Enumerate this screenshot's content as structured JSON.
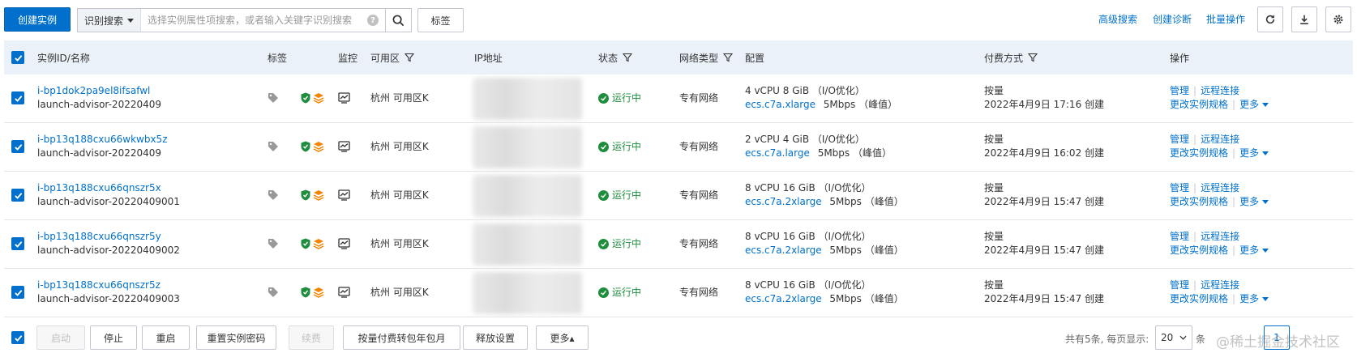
{
  "toolbar": {
    "create_label": "创建实例",
    "search_mode": "识别搜索",
    "search_placeholder": "选择实例属性项搜索，或者输入关键字识别搜索",
    "tag_label": "标签",
    "advanced_search": "高级搜索",
    "create_diagnosis": "创建诊断",
    "batch_ops": "批量操作"
  },
  "columns": {
    "instance": "实例ID/名称",
    "tags": "标签",
    "monitor": "监控",
    "zone": "可用区",
    "ip": "IP地址",
    "status": "状态",
    "network": "网络类型",
    "config": "配置",
    "billing": "付费方式",
    "actions": "操作"
  },
  "rows": [
    {
      "id": "i-bp1dok2pa9el8ifsafwl",
      "name": "launch-advisor-20220409",
      "zone": "杭州 可用区K",
      "status": "运行中",
      "network": "专有网络",
      "spec": "4 vCPU 8 GiB （I/O优化）",
      "type": "ecs.c7a.xlarge",
      "bandwidth": "5Mbps （峰值）",
      "billing": "按量",
      "created": "2022年4月9日 17:16 创建"
    },
    {
      "id": "i-bp13q188cxu66wkwbx5z",
      "name": "launch-advisor-20220409",
      "zone": "杭州 可用区K",
      "status": "运行中",
      "network": "专有网络",
      "spec": "2 vCPU 4 GiB （I/O优化）",
      "type": "ecs.c7a.large",
      "bandwidth": "5Mbps （峰值）",
      "billing": "按量",
      "created": "2022年4月9日 16:02 创建"
    },
    {
      "id": "i-bp13q188cxu66qnszr5x",
      "name": "launch-advisor-20220409001",
      "zone": "杭州 可用区K",
      "status": "运行中",
      "network": "专有网络",
      "spec": "8 vCPU 16 GiB （I/O优化）",
      "type": "ecs.c7a.2xlarge",
      "bandwidth": "5Mbps （峰值）",
      "billing": "按量",
      "created": "2022年4月9日 15:47 创建"
    },
    {
      "id": "i-bp13q188cxu66qnszr5y",
      "name": "launch-advisor-20220409002",
      "zone": "杭州 可用区K",
      "status": "运行中",
      "network": "专有网络",
      "spec": "8 vCPU 16 GiB （I/O优化）",
      "type": "ecs.c7a.2xlarge",
      "bandwidth": "5Mbps （峰值）",
      "billing": "按量",
      "created": "2022年4月9日 15:47 创建"
    },
    {
      "id": "i-bp13q188cxu66qnszr5z",
      "name": "launch-advisor-20220409003",
      "zone": "杭州 可用区K",
      "status": "运行中",
      "network": "专有网络",
      "spec": "8 vCPU 16 GiB （I/O优化）",
      "type": "ecs.c7a.2xlarge",
      "bandwidth": "5Mbps （峰值）",
      "billing": "按量",
      "created": "2022年4月9日 15:47 创建"
    }
  ],
  "row_actions": {
    "manage": "管理",
    "remote": "远程连接",
    "change_spec": "更改实例规格",
    "more": "更多"
  },
  "footer": {
    "start": "启动",
    "stop": "停止",
    "restart": "重启",
    "reset_password": "重置实例密码",
    "renew": "续费",
    "convert_billing": "按量付费转包年包月",
    "release": "释放设置",
    "more": "更多▴",
    "total": "共有5条, 每页显示:",
    "page_size": "20",
    "page_unit": "条",
    "current_page": "1",
    "watermark": "@稀土掘金技术社区"
  },
  "colors": {
    "primary": "#0070cc",
    "running": "#1e8e3e",
    "header_bg": "#ebf1f8",
    "security": "#1e8e3e",
    "orange": "#f38400"
  }
}
